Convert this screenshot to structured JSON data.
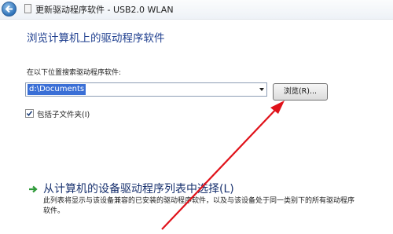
{
  "window": {
    "title": "更新驱动程序软件 - USB2.0 WLAN",
    "icons": {
      "back": "back-arrow-icon",
      "title": "device-icon"
    }
  },
  "main": {
    "heading": "浏览计算机上的驱动程序软件",
    "search_label": "在以下位置搜索驱动程序软件:",
    "path_value": "d:\\Documents",
    "browse_button": "浏览(R)...",
    "include_subfolders": {
      "label": "包括子文件夹(I)",
      "checked": true
    },
    "pick_from_list": {
      "title": "从计算机的设备驱动程序列表中选择(L)",
      "description": "此列表将显示与该设备兼容的已安装的驱动程序软件，以及与该设备处于同一类别下的所有驱动程序软件。"
    }
  },
  "annotation": {
    "color": "#e0121a"
  },
  "colors": {
    "heading": "#1f3f8f",
    "selection": "#3a6fd6",
    "link_arrow": "#2f9a3a"
  }
}
